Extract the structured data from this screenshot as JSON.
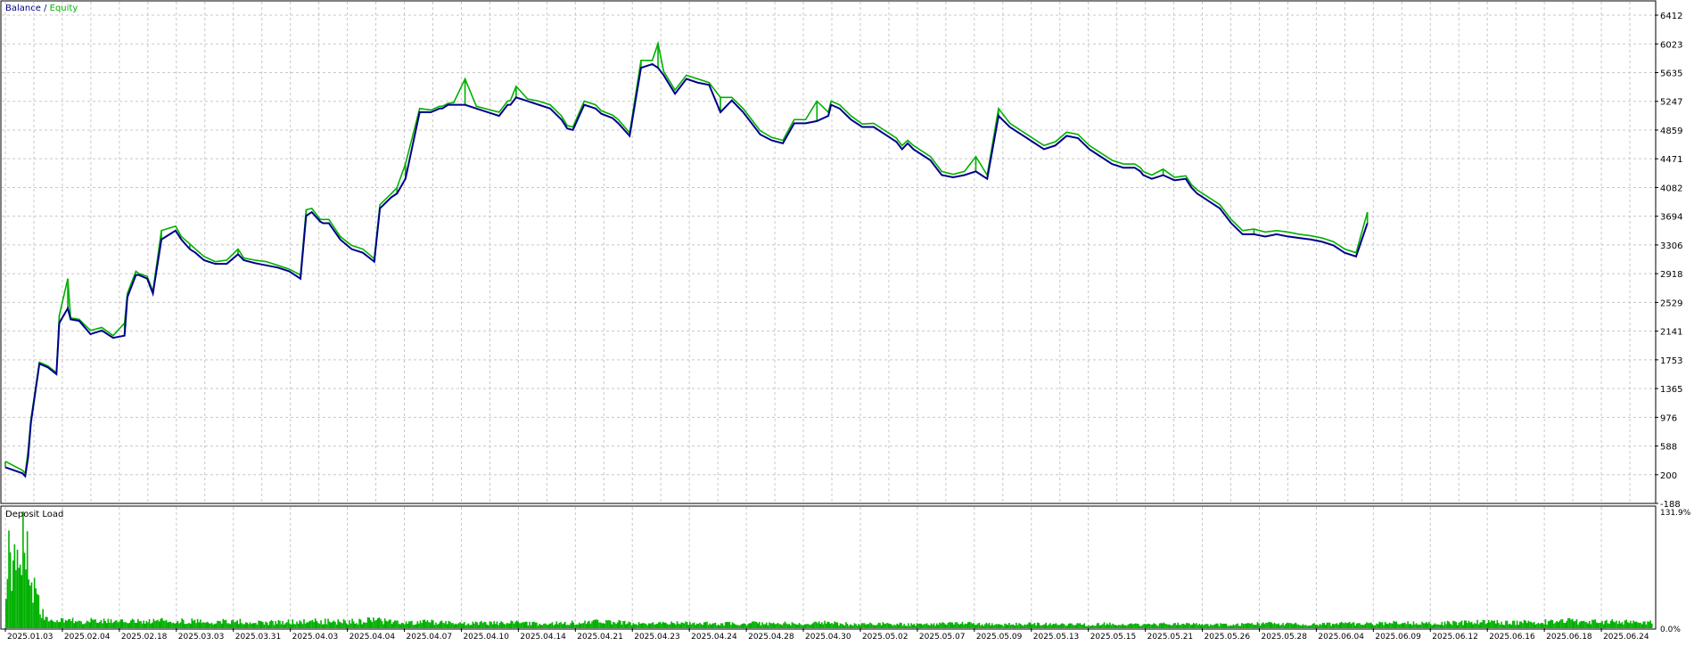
{
  "colors": {
    "background": "#ffffff",
    "grid": "#c8c8c8",
    "frame": "#000000",
    "balance": "#00008b",
    "equity": "#00b000",
    "deposit_load": "#00b000"
  },
  "legend": {
    "balance_label": "Balance",
    "separator": " / ",
    "equity_label": "Equity"
  },
  "chart_data": [
    {
      "type": "line",
      "title": "Balance / Equity",
      "ylim": [
        -188,
        6412
      ],
      "y_ticks": [
        "6412",
        "6023",
        "5635",
        "5247",
        "4859",
        "4471",
        "4082",
        "3694",
        "3306",
        "2918",
        "2529",
        "2141",
        "1753",
        "1365",
        "976",
        "588",
        "200",
        "-188"
      ],
      "grid": true,
      "legend_position": "top-left",
      "series": [
        {
          "name": "Balance",
          "x_index": [
            0,
            6,
            7,
            8,
            9,
            12,
            15,
            18,
            19,
            22,
            23,
            26,
            30,
            34,
            38,
            42,
            43,
            46,
            47,
            50,
            52,
            55,
            60,
            62,
            65,
            67,
            70,
            74,
            78,
            82,
            84,
            88,
            92,
            96,
            100,
            104,
            106,
            108,
            111,
            112,
            114,
            118,
            122,
            126,
            130,
            132,
            136,
            138,
            141,
            146,
            150,
            153,
            154,
            156,
            158,
            162,
            166,
            170,
            174,
            177,
            178,
            180,
            184,
            188,
            192,
            196,
            198,
            200,
            204,
            208,
            210,
            214,
            216,
            220,
            224,
            228,
            230,
            232,
            236,
            240,
            244,
            248,
            252,
            256,
            260,
            264,
            266,
            270,
            274,
            278,
            282,
            286,
            290,
            291,
            294,
            298,
            302,
            306,
            310,
            314,
            316,
            318,
            320,
            324,
            326,
            328,
            330,
            334,
            338,
            342,
            346,
            350,
            354,
            358,
            362,
            366,
            370,
            374,
            378,
            382,
            386,
            390,
            394,
            398,
            400,
            401,
            404,
            408,
            412,
            416,
            418,
            420,
            424,
            428,
            432,
            436,
            440,
            444,
            448,
            452,
            456,
            460,
            464,
            468,
            472,
            476,
            480,
            484,
            488,
            492,
            496,
            500,
            502,
            504,
            506,
            508,
            510,
            514,
            518,
            522,
            526,
            530,
            534,
            538,
            542,
            546,
            550,
            554,
            558,
            562,
            566,
            570,
            574,
            578,
            580
          ],
          "values": [
            300,
            220,
            180,
            430,
            900,
            1700,
            1650,
            1560,
            2250,
            2450,
            2300,
            2280,
            2100,
            2150,
            2050,
            2080,
            2600,
            2900,
            2900,
            2850,
            2650,
            3380,
            3500,
            3380,
            3250,
            3200,
            3100,
            3050,
            3050,
            3180,
            3100,
            3060,
            3030,
            3000,
            2950,
            2850,
            3700,
            3750,
            3620,
            3600,
            3600,
            3380,
            3250,
            3200,
            3080,
            3800,
            3950,
            4000,
            4200,
            5100,
            5100,
            5150,
            5150,
            5200,
            5200,
            5200,
            5150,
            5100,
            5050,
            5200,
            5200,
            5300,
            5250,
            5200,
            5150,
            5000,
            4880,
            4860,
            5200,
            5150,
            5080,
            5020,
            4950,
            4780,
            5700,
            5750,
            5700,
            5600,
            5350,
            5550,
            5500,
            5470,
            5100,
            5260,
            5100,
            4900,
            4800,
            4720,
            4680,
            4950,
            4950,
            4980,
            5050,
            5200,
            5150,
            5000,
            4900,
            4900,
            4800,
            4700,
            4600,
            4680,
            4600,
            4500,
            4450,
            4350,
            4250,
            4220,
            4250,
            4300,
            4200,
            5050,
            4900,
            4800,
            4700,
            4600,
            4650,
            4780,
            4750,
            4600,
            4500,
            4400,
            4350,
            4350,
            4300,
            4250,
            4200,
            4250,
            4180,
            4200,
            4080,
            4000,
            3900,
            3800,
            3600,
            3450,
            3450,
            3420,
            3450,
            3420,
            3400,
            3380,
            3350,
            3300,
            3200,
            3150,
            3600
          ]
        },
        {
          "name": "Equity",
          "x_index": [
            0,
            6,
            7,
            8,
            9,
            12,
            15,
            18,
            19,
            22,
            23,
            26,
            30,
            34,
            38,
            42,
            43,
            46,
            47,
            50,
            52,
            55,
            60,
            62,
            65,
            67,
            70,
            74,
            78,
            82,
            84,
            88,
            92,
            96,
            100,
            104,
            106,
            108,
            111,
            112,
            114,
            118,
            122,
            126,
            130,
            132,
            136,
            138,
            141,
            146,
            150,
            153,
            154,
            156,
            158,
            162,
            166,
            170,
            174,
            177,
            178,
            180,
            184,
            188,
            192,
            196,
            198,
            200,
            204,
            208,
            210,
            214,
            216,
            220,
            224,
            228,
            230,
            232,
            236,
            240,
            244,
            248,
            252,
            256,
            260,
            264,
            266,
            270,
            274,
            278,
            282,
            286,
            290,
            291,
            294,
            298,
            302,
            306,
            310,
            314,
            316,
            318,
            320,
            324,
            326,
            328,
            330,
            334,
            338,
            342,
            346,
            350,
            354,
            358,
            362,
            366,
            370,
            374,
            378,
            382,
            386,
            390,
            394,
            398,
            400,
            401,
            404,
            408,
            412,
            416,
            418,
            420,
            424,
            428,
            432,
            436,
            440,
            444,
            448,
            452,
            456,
            460,
            464,
            468,
            472,
            476,
            480,
            484,
            488,
            492,
            496,
            500,
            502,
            504,
            506,
            508,
            510,
            514,
            518,
            522,
            526,
            530,
            534,
            538,
            542,
            546,
            550,
            554,
            558,
            562,
            566,
            570,
            574,
            578,
            580
          ],
          "values": [
            380,
            260,
            220,
            520,
            950,
            1720,
            1670,
            1580,
            2350,
            2850,
            2320,
            2300,
            2150,
            2190,
            2080,
            2250,
            2650,
            2950,
            2920,
            2880,
            2680,
            3500,
            3560,
            3420,
            3320,
            3250,
            3150,
            3080,
            3100,
            3250,
            3130,
            3100,
            3080,
            3030,
            2980,
            2900,
            3780,
            3800,
            3650,
            3650,
            3650,
            3420,
            3300,
            3250,
            3120,
            3850,
            4000,
            4080,
            4400,
            5150,
            5130,
            5180,
            5180,
            5220,
            5230,
            5550,
            5180,
            5140,
            5100,
            5250,
            5260,
            5450,
            5280,
            5250,
            5200,
            5050,
            4920,
            4900,
            5250,
            5200,
            5120,
            5060,
            5000,
            4820,
            5800,
            5800,
            6030,
            5650,
            5400,
            5600,
            5550,
            5500,
            5300,
            5300,
            5150,
            4950,
            4850,
            4760,
            4720,
            5000,
            5000,
            5250,
            5100,
            5250,
            5200,
            5050,
            4940,
            4950,
            4850,
            4750,
            4650,
            4720,
            4650,
            4550,
            4500,
            4400,
            4300,
            4260,
            4300,
            4500,
            4250,
            5150,
            4950,
            4850,
            4750,
            4650,
            4700,
            4830,
            4800,
            4650,
            4550,
            4450,
            4400,
            4400,
            4350,
            4300,
            4250,
            4330,
            4220,
            4240,
            4120,
            4050,
            3950,
            3850,
            3650,
            3500,
            3520,
            3480,
            3500,
            3480,
            3450,
            3430,
            3400,
            3350,
            3250,
            3200,
            3750
          ]
        }
      ]
    },
    {
      "type": "bar",
      "title": "Deposit Load",
      "ylim": [
        0,
        131.9
      ],
      "y_ticks": [
        "131.9%",
        "0.0%"
      ],
      "legend_position": "top-left",
      "series": [
        {
          "name": "Deposit Load",
          "x_index": [
            0,
            1,
            2,
            3,
            4,
            5,
            6,
            7,
            8,
            9,
            10,
            11,
            12,
            13,
            14,
            15,
            16,
            20,
            30,
            40,
            50,
            60,
            70,
            80,
            90,
            100,
            110,
            120,
            130,
            140,
            150,
            160,
            170,
            180,
            190,
            200,
            210,
            220,
            230,
            240,
            250,
            260,
            270,
            280,
            290,
            300,
            310,
            320,
            330,
            340,
            350,
            360,
            370,
            380,
            390,
            400,
            410,
            420,
            430,
            440,
            450,
            460,
            470,
            480,
            490,
            500,
            510,
            520,
            530,
            540,
            550,
            560,
            570,
            580
          ],
          "values": [
            60,
            80,
            70,
            90,
            100,
            75,
            131.9,
            95,
            65,
            50,
            40,
            30,
            22,
            15,
            10,
            8,
            7,
            9,
            8,
            7,
            8,
            9,
            7,
            8,
            6,
            7,
            8,
            7,
            9,
            6,
            7,
            5,
            6,
            6,
            5,
            6,
            7,
            6,
            5,
            6,
            5,
            5,
            6,
            5,
            6,
            4,
            5,
            4,
            5,
            5,
            4,
            5,
            4,
            4,
            5,
            4,
            5,
            4,
            4,
            5,
            5,
            4,
            5,
            5,
            6,
            5,
            6,
            7,
            6,
            7,
            8,
            7,
            7,
            6
          ]
        }
      ],
      "x_categories": [
        "2025.01.03",
        "2025.02.04",
        "2025.02.18",
        "2025.03.03",
        "2025.03.31",
        "2025.04.03",
        "2025.04.04",
        "2025.04.07",
        "2025.04.10",
        "2025.04.14",
        "2025.04.21",
        "2025.04.23",
        "2025.04.24",
        "2025.04.28",
        "2025.04.30",
        "2025.05.02",
        "2025.05.07",
        "2025.05.09",
        "2025.05.13",
        "2025.05.15",
        "2025.05.21",
        "2025.05.26",
        "2025.05.28",
        "2025.06.04",
        "2025.06.09",
        "2025.06.12",
        "2025.06.16",
        "2025.06.18",
        "2025.06.24"
      ],
      "x_index_max": 580
    }
  ],
  "deposit_label": "Deposit Load"
}
